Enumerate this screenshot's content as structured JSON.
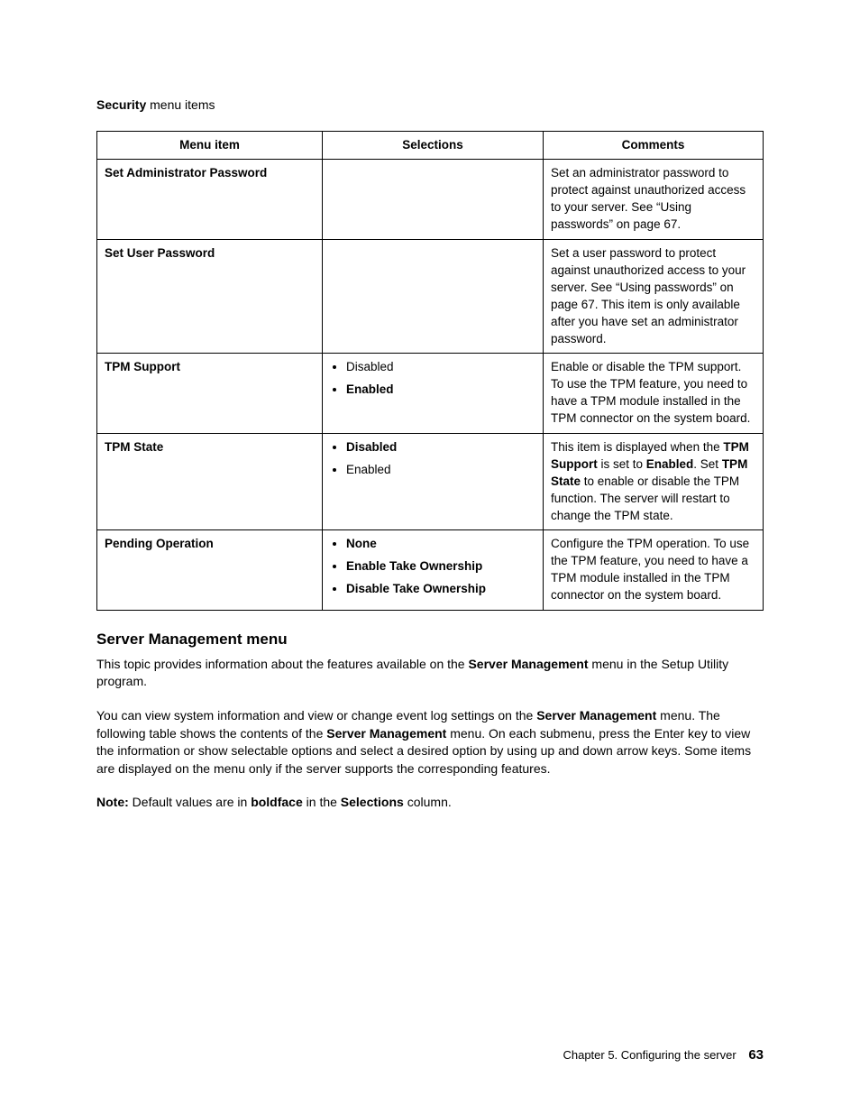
{
  "heading": {
    "bold": "Security",
    "rest": " menu items"
  },
  "table": {
    "headers": {
      "c1": "Menu item",
      "c2": "Selections",
      "c3": "Comments"
    },
    "rows": [
      {
        "item": "Set Administrator Password",
        "selections": [],
        "comment_parts": [
          {
            "t": "Set an administrator password to protect against unauthorized access to your server. See “Using passwords” on page 67."
          }
        ]
      },
      {
        "item": "Set User Password",
        "selections": [],
        "comment_parts": [
          {
            "t": "Set a user password to protect against unauthorized access to your server. See “Using passwords” on page 67. This item is only available after you have set an administrator password."
          }
        ]
      },
      {
        "item": "TPM Support",
        "selections": [
          {
            "label": "Disabled",
            "bold": false
          },
          {
            "label": "Enabled",
            "bold": true
          }
        ],
        "comment_parts": [
          {
            "t": "Enable or disable the TPM support. To use the TPM feature, you need to have a TPM module installed in the TPM connector on the system board."
          }
        ]
      },
      {
        "item": "TPM State",
        "selections": [
          {
            "label": "Disabled",
            "bold": true
          },
          {
            "label": "Enabled",
            "bold": false
          }
        ],
        "comment_parts": [
          {
            "t": "This item is displayed when the "
          },
          {
            "t": "TPM Support",
            "b": true
          },
          {
            "t": " is set to "
          },
          {
            "t": "Enabled",
            "b": true
          },
          {
            "t": ". Set "
          },
          {
            "t": "TPM State",
            "b": true
          },
          {
            "t": " to enable or disable the TPM function. The server will restart to change the TPM state."
          }
        ]
      },
      {
        "item": "Pending Operation",
        "selections": [
          {
            "label": "None",
            "bold": true
          },
          {
            "label": "Enable Take Ownership",
            "bold": true
          },
          {
            "label": "Disable Take Ownership",
            "bold": true
          }
        ],
        "comment_parts": [
          {
            "t": "Configure the TPM operation. To use the TPM feature, you need to have a TPM module installed in the TPM connector on the system board."
          }
        ]
      }
    ]
  },
  "section_heading": "Server Management menu",
  "para1_parts": [
    {
      "t": "This topic provides information about the features available on the "
    },
    {
      "t": "Server Management",
      "b": true
    },
    {
      "t": " menu in the Setup Utility program."
    }
  ],
  "para2_parts": [
    {
      "t": "You can view system information and view or change event log settings on the "
    },
    {
      "t": "Server Management",
      "b": true
    },
    {
      "t": " menu. The following table shows the contents of the "
    },
    {
      "t": "Server Management",
      "b": true
    },
    {
      "t": " menu. On each submenu, press the Enter key to view the information or show selectable options and select a desired option by using up and down arrow keys. Some items are displayed on the menu only if the server supports the corresponding features."
    }
  ],
  "note_parts": [
    {
      "t": "Note:",
      "b": true
    },
    {
      "t": " Default values are in "
    },
    {
      "t": "boldface",
      "b": true
    },
    {
      "t": " in the "
    },
    {
      "t": "Selections",
      "b": true
    },
    {
      "t": " column."
    }
  ],
  "footer": {
    "chapter": "Chapter 5. Configuring the server",
    "page": "63"
  }
}
